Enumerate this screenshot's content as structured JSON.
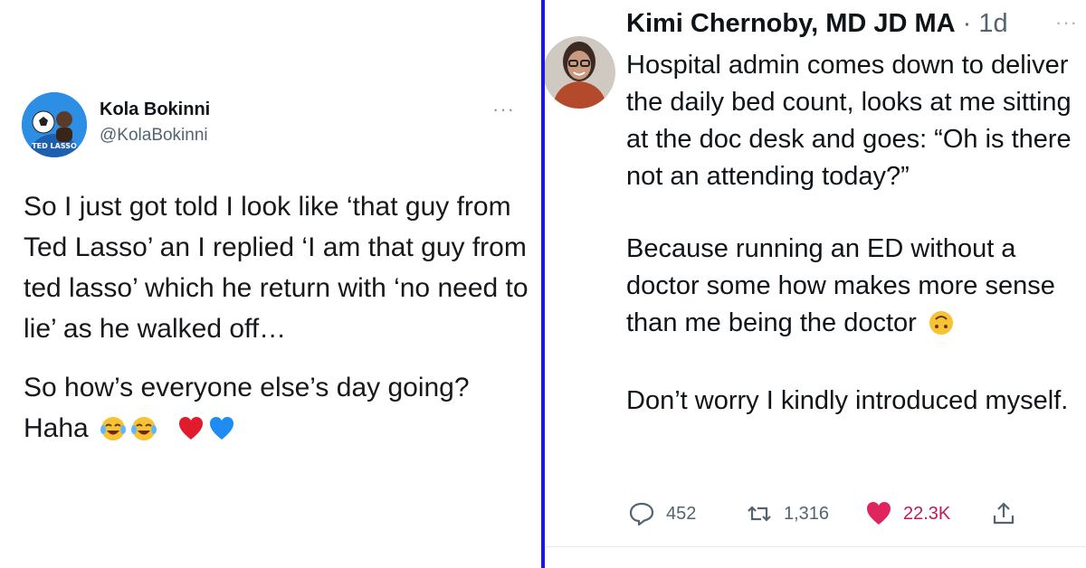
{
  "left_tweet": {
    "name": "Kola Bokinni",
    "handle": "@KolaBokinni",
    "avatar_text": "TED LASSO",
    "more": "···",
    "paragraph1": "So I just got told I look like ‘that guy from Ted Lasso’ an I replied ‘I am that guy from ted lasso’ which he return with ‘no need to lie’ as he walked off…",
    "paragraph2_line1": "So how’s everyone else’s day going?",
    "paragraph2_line2": "Haha",
    "emojis": [
      "tears-of-joy",
      "tears-of-joy",
      "red-heart",
      "blue-heart"
    ]
  },
  "right_tweet": {
    "name": "Kimi Chernoby, MD JD MA",
    "separator": " · ",
    "time": "1d",
    "more": "···",
    "paragraph1": "Hospital admin comes down to deliver the daily bed count, looks at me sitting at the doc desk and goes: “Oh is there not an attending today?”",
    "paragraph2": "Because running an ED without a doctor some how makes more sense than me being the doctor",
    "paragraph2_emoji": "upside-down-face",
    "paragraph3": "Don’t worry I kindly introduced myself.",
    "actions": {
      "replies": "452",
      "retweets": "1,316",
      "likes": "22.3K"
    },
    "colors": {
      "like": "#e0245e",
      "muted": "#536471"
    }
  },
  "divider_color": "#1f16e6"
}
